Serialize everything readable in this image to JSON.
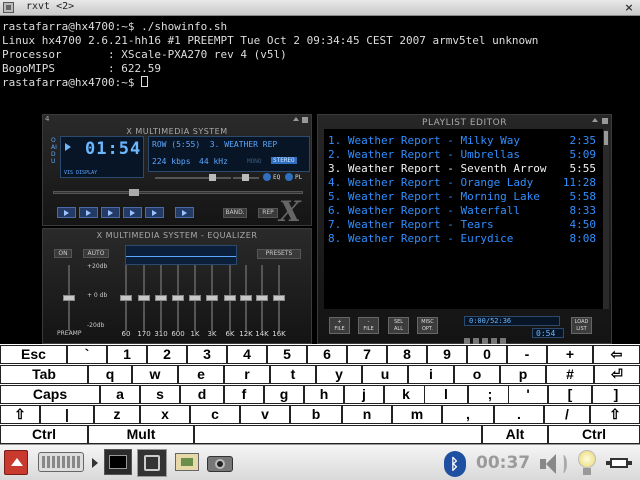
{
  "window": {
    "title": "rxvt <2>",
    "close_label": "×"
  },
  "terminal": {
    "lines": [
      "rastafarra@hx4700:~$ ./showinfo.sh",
      "Linux hx4700 2.6.21-hh16 #1 PREEMPT Tue Oct 2 09:34:45 CEST 2007 armv5tel unknown",
      "Processor       : XScale-PXA270 rev 4 (v5l)",
      "BogoMIPS        : 622.59"
    ],
    "prompt": "rastafarra@hx4700:~$ "
  },
  "xmms": {
    "main": {
      "title": "X MULTIMEDIA SYSTEM",
      "time": "01:54",
      "song_display": "ROW (5:55)  3. WEATHER REP",
      "bitrate": "224 kbps",
      "samplerate": "44 kHz",
      "mono": "MONO",
      "stereo": "STEREO",
      "eq_label": "EQ",
      "pl_label": "PL",
      "bitrate_label": "BITRATE",
      "vis_label": "VIS DISPLAY",
      "band_label": "BAND.",
      "rep_label": "REP",
      "side_label": "OAIDU",
      "logo": "X"
    },
    "equalizer": {
      "title": "X MULTIMEDIA SYSTEM - EQUALIZER",
      "on_label": "ON",
      "auto_label": "AUTO",
      "presets_label": "PRESETS",
      "db_top": "+20db",
      "db_mid": "+ 0 db",
      "db_bot": "-20db",
      "preamp_label": "PREAMP",
      "bands": [
        {
          "label": "60",
          "level": 0.0
        },
        {
          "label": "170",
          "level": 0.0
        },
        {
          "label": "310",
          "level": 0.0
        },
        {
          "label": "600",
          "level": 0.0
        },
        {
          "label": "1K",
          "level": 0.0
        },
        {
          "label": "3K",
          "level": 0.0
        },
        {
          "label": "6K",
          "level": 0.0
        },
        {
          "label": "12K",
          "level": 0.0
        },
        {
          "label": "14K",
          "level": 0.0
        },
        {
          "label": "16K",
          "level": 0.0
        }
      ]
    },
    "playlist": {
      "title": "PLAYLIST EDITOR",
      "items": [
        {
          "title": "1. Weather Report - Milky Way",
          "duration": "2:35"
        },
        {
          "title": "2. Weather Report - Umbrellas",
          "duration": "5:09"
        },
        {
          "title": "3. Weather Report - Seventh Arrow",
          "duration": "5:55"
        },
        {
          "title": "4. Weather Report - Orange Lady",
          "duration": "11:28"
        },
        {
          "title": "5. Weather Report - Morning Lake",
          "duration": "5:58"
        },
        {
          "title": "6. Weather Report - Waterfall",
          "duration": "8:33"
        },
        {
          "title": "7. Weather Report - Tears",
          "duration": "4:50"
        },
        {
          "title": "8. Weather Report - Eurydice",
          "duration": "8:08"
        }
      ],
      "current_index": 2,
      "total_time": "0:00/52:36",
      "mini_time": "0:54",
      "buttons": [
        {
          "name": "add-file",
          "line1": "+",
          "line2": "FILE"
        },
        {
          "name": "remove-file",
          "line1": "-",
          "line2": "FILE"
        },
        {
          "name": "select-all",
          "line1": "SEL",
          "line2": "ALL"
        },
        {
          "name": "misc-options",
          "line1": "MISC",
          "line2": "OPT."
        },
        {
          "name": "load-list",
          "line1": "LOAD",
          "line2": "LIST"
        }
      ]
    },
    "colors": {
      "lcd_text": "#5aa7ff",
      "playlist_text": "#2f8fff",
      "playlist_current": "#f2f2f2"
    }
  },
  "keyboard": {
    "rows": [
      [
        "Esc",
        "`",
        "1",
        "2",
        "3",
        "4",
        "5",
        "6",
        "7",
        "8",
        "9",
        "0",
        "-",
        "+",
        "⇦"
      ],
      [
        "Tab",
        "q",
        "w",
        "e",
        "r",
        "t",
        "y",
        "u",
        "i",
        "o",
        "p",
        "#",
        "⏎"
      ],
      [
        "Caps",
        "a",
        "s",
        "d",
        "f",
        "g",
        "h",
        "j",
        "k",
        "l",
        ";",
        "'",
        "[",
        "]"
      ],
      [
        "⇧",
        "|",
        "z",
        "x",
        "c",
        "v",
        "b",
        "n",
        "m",
        ",",
        ".",
        "/",
        "⇧"
      ],
      [
        "Ctrl",
        "Mult",
        "",
        "Alt",
        "Ctrl"
      ]
    ]
  },
  "taskbar": {
    "clock": "00:37",
    "icons": [
      "menu-icon",
      "keyboard-icon",
      "terminal-icon",
      "xmms-icon",
      "image-viewer-icon",
      "camera-icon",
      "bluetooth-icon",
      "volume-icon",
      "lightbulb-icon",
      "battery-icon"
    ]
  }
}
